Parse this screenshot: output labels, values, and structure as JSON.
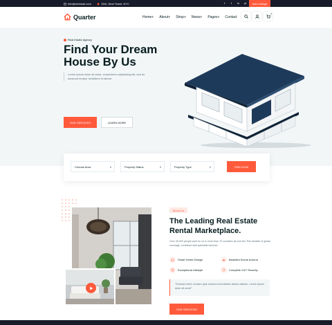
{
  "topbar": {
    "email": "info@webmail.com",
    "address": "15/A, Nest Tower, NYC",
    "socials": [
      "f",
      "t",
      "in",
      "yt",
      "be"
    ],
    "add_listing": "Add Listings"
  },
  "header": {
    "logo": "Quarter",
    "nav": [
      "Home",
      "About",
      "Shop",
      "News",
      "Pages",
      "Contact"
    ],
    "cart_count": "0"
  },
  "hero": {
    "tag": "Real Estate Agency",
    "title": "Find Your Dream House By Us",
    "description": "Lorem ipsum dolor sit amet, consectetur adipisicing elit, sed do eiusmod tempor incididunt ut labore.",
    "primary_button": "OUR SERVICES",
    "secondary_button": "LEARN MORE"
  },
  "search": {
    "area": "Choose Area",
    "status": "Property Status",
    "type": "Property Type",
    "button": "FIND NOW"
  },
  "about": {
    "badge": "About Us",
    "title": "The Leading Real Estate Rental Marketplace.",
    "description": "Over 39,000 people work for us in more than 70 countries all over the This breadth of global coverage, combined with specialist services",
    "features": [
      "Smart Home Design",
      "Beautiful Scene Around",
      "Exceptional Lifestyle",
      "Complete 24/7 Security"
    ],
    "quote": "\"Enimad minim veniam quis nostrud exercitation llamco laboris. Lorem ipsum dolor sit amet\"",
    "button": "OUR SERVICES"
  },
  "colors": {
    "accent": "#ff5a3c",
    "dark": "#071c1f",
    "topbar": "#171b2a",
    "hero_bg": "#f2f6f7"
  }
}
